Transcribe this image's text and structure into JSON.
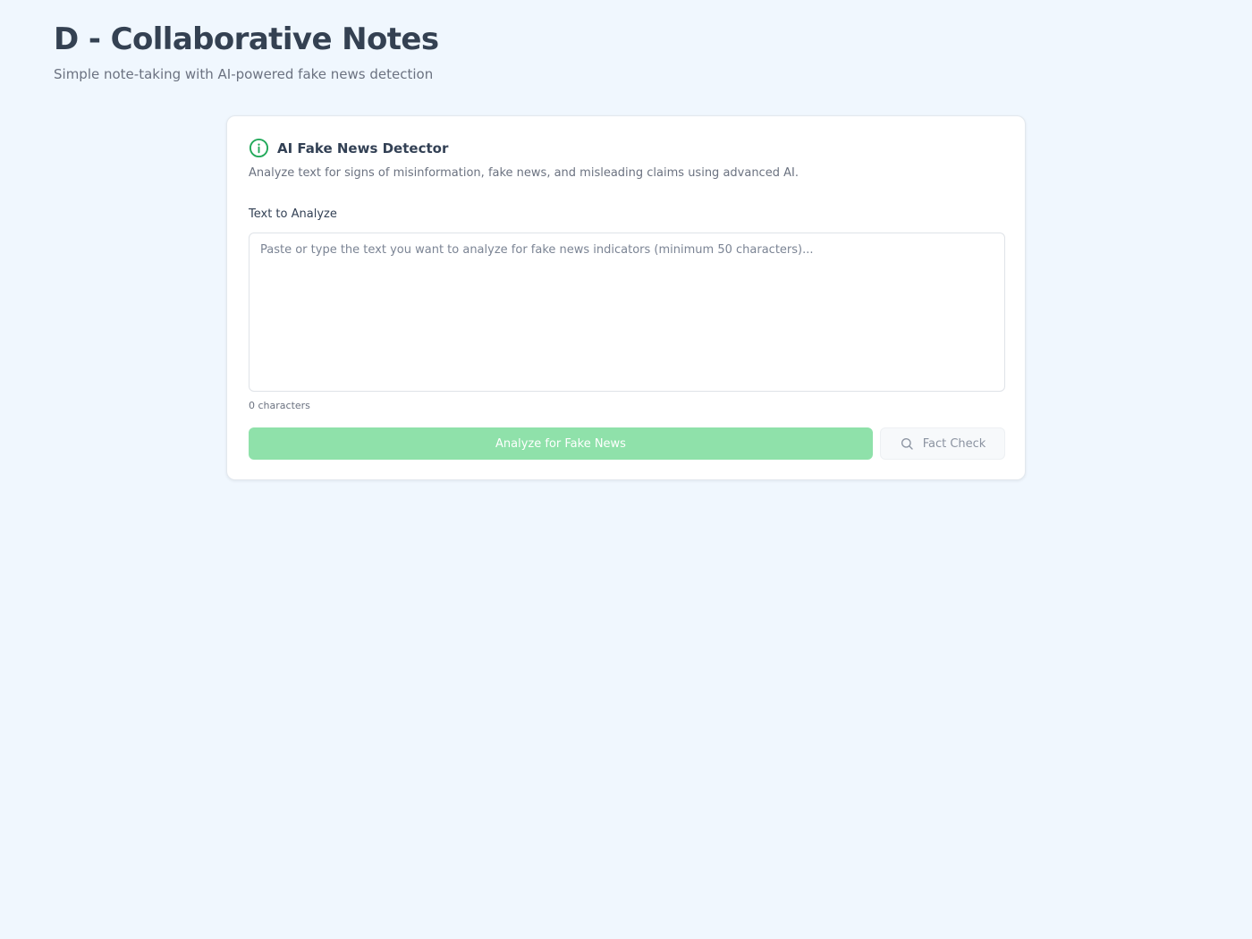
{
  "header": {
    "title": "D - Collaborative Notes",
    "subtitle": "Simple note-taking with AI-powered fake news detection"
  },
  "detector": {
    "icon": "info-icon",
    "title": "AI Fake News Detector",
    "description": "Analyze text for signs of misinformation, fake news, and misleading claims using advanced AI.",
    "field_label": "Text to Analyze",
    "input_value": "",
    "input_placeholder": "Paste or type the text you want to analyze for fake news indicators (minimum 50 characters)...",
    "char_count": "0 characters",
    "analyze_label": "Analyze for Fake News",
    "fact_check_icon": "search-icon",
    "fact_check_label": "Fact Check"
  },
  "colors": {
    "page_background": "#f0f7fe",
    "accent_green": "#22a95a",
    "analyze_button_disabled": "#8fe1aa",
    "title_text": "#344152",
    "muted_text": "#6b7280"
  }
}
